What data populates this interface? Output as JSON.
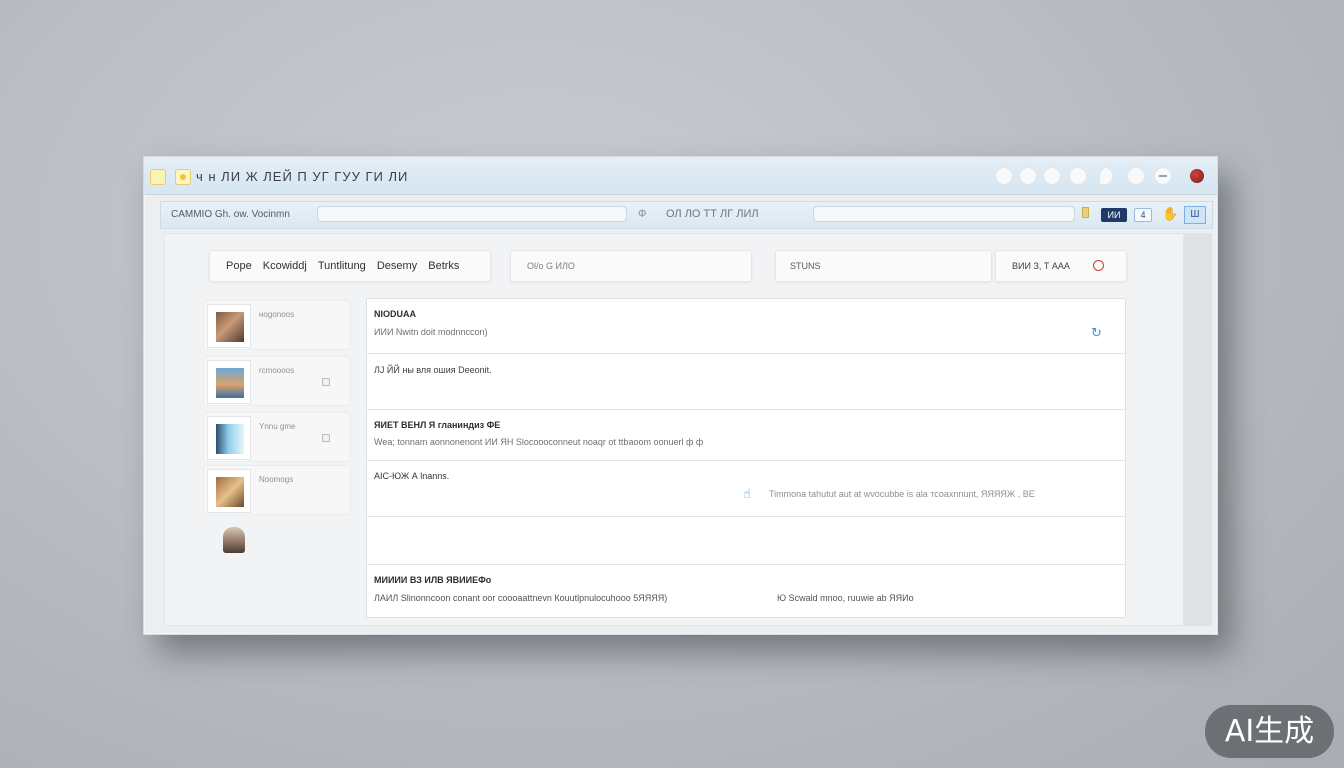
{
  "window": {
    "title": "ч н ЛИ Ж ЛЕЙ П УГ ГУУ ГИ ЛИ"
  },
  "toolbar": {
    "label": "CAMMIO Gh. ow. Vocinmn",
    "icons": [
      "Ф",
      "ОЛ ЛО ТТ ЛГ ЛИЛ"
    ],
    "badge_dark": "ИИ",
    "badge_light": "4",
    "badge_blue": "Ш"
  },
  "tabs": {
    "items": [
      "Pope",
      "Kcowiddj",
      "Tuntlitung",
      "Desemy",
      "Betrks"
    ]
  },
  "search_pill": {
    "text": "Ol/o G ИЛО"
  },
  "status_pill": {
    "text": "STUNS"
  },
  "action_pill": {
    "text": "ВИИ З, Т ААА"
  },
  "sidebar": {
    "items": [
      {
        "label": "ноgonoos"
      },
      {
        "label": "rcmoooos"
      },
      {
        "label": "Ynnu gme"
      },
      {
        "label": "Noomogs"
      }
    ]
  },
  "rows": [
    {
      "title": "NIODUAA",
      "sub": "ИИИ Nwitn doit modnnccon)"
    },
    {
      "sub": "ЛЈ ЙЙ ны вля ошия Deeonit."
    },
    {
      "title": "ЯИЕТ ВЕНЛ Я гланиндиз ФЕ",
      "sub": "Wea; tоnnam аonnonenont ИИ ЯН Slocoooconneut noaqr ot ttbaoom oonuerl ф ф"
    },
    {
      "title": "AIC-ЮЖ А lnanns.",
      "side": "Timmona tahutut aut at wvocubbe is ala тсоахnnunt, ЯЯЯЯЖ , ВЕ"
    },
    {
      "title": "МИИИИ ВЗ ИЛВ ЯВИИЕФо",
      "sub": "ЛАИЛ Slinonncoon conant ооr coooaattnevn Коuutlpnulocuhooo 5ЯЯЯЯ)",
      "side": "Ю Scwald mnoo, ruuwie ab ЯЯИо"
    }
  ],
  "watermark": {
    "text": "AI生成"
  }
}
